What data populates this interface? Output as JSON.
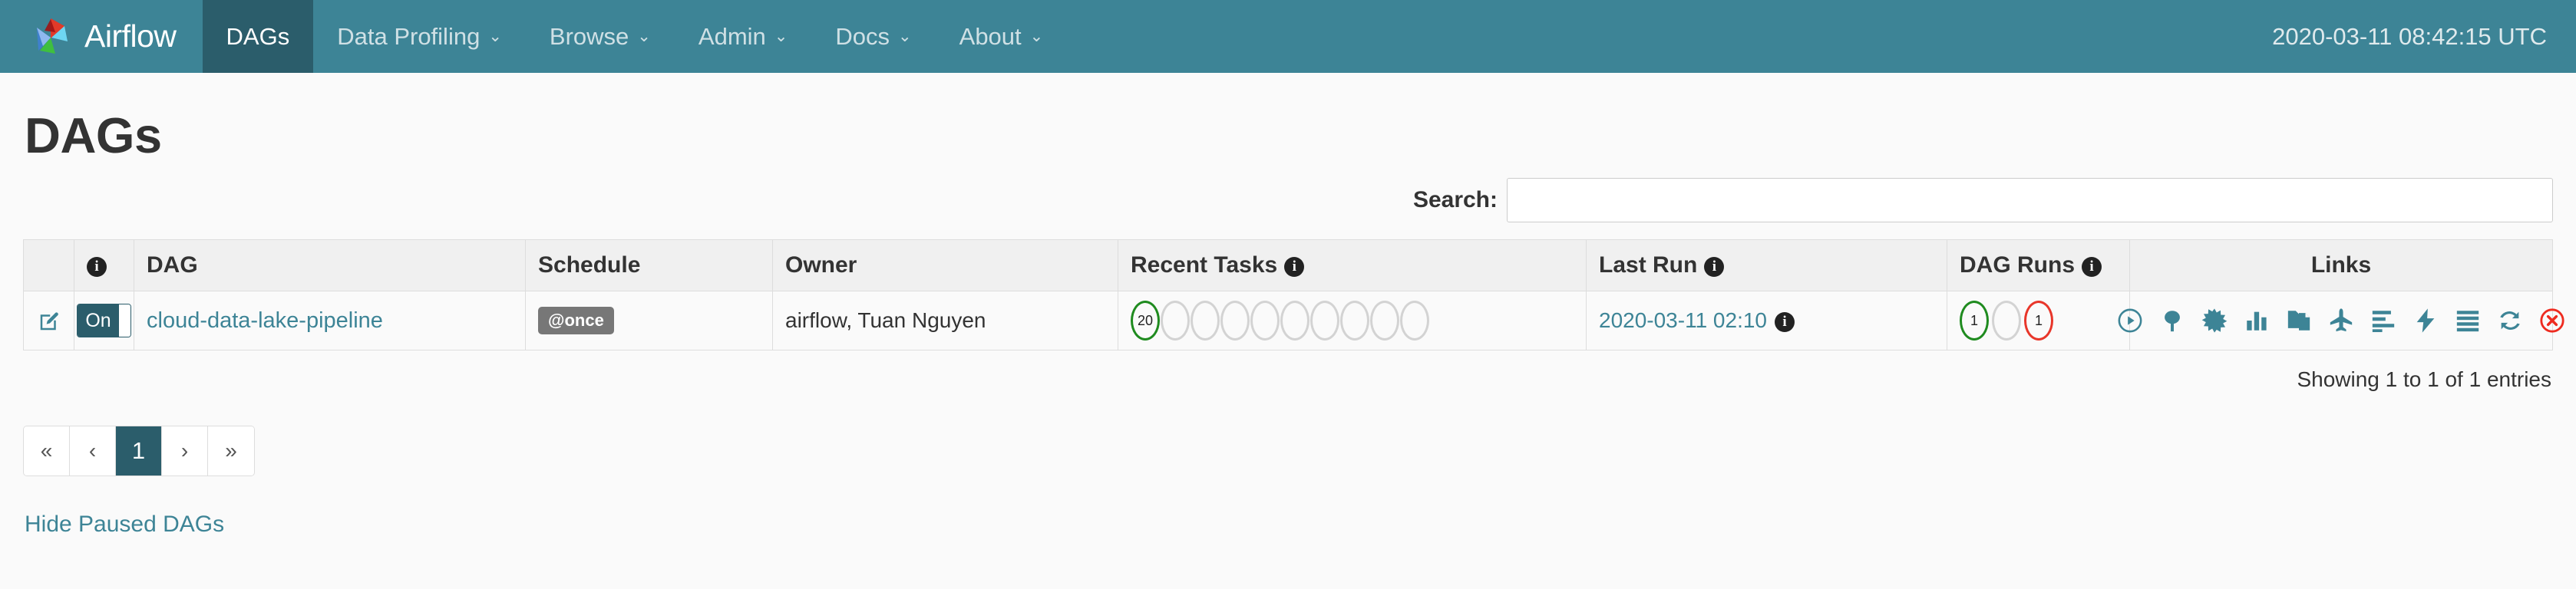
{
  "navbar": {
    "brand_label": "Airflow",
    "brand_icon": "airflow-pinwheel-logo",
    "items": [
      {
        "label": "DAGs",
        "caret": "",
        "active": true
      },
      {
        "label": "Data Profiling",
        "caret": "⌄",
        "active": false
      },
      {
        "label": "Browse",
        "caret": "⌄",
        "active": false
      },
      {
        "label": "Admin",
        "caret": "⌄",
        "active": false
      },
      {
        "label": "Docs",
        "caret": "⌄",
        "active": false
      },
      {
        "label": "About",
        "caret": "⌄",
        "active": false
      }
    ],
    "clock": "2020-03-11 08:42:15 UTC",
    "bg_color": "#3d8496",
    "active_bg_color": "#2b5d6b"
  },
  "page": {
    "title": "DAGs"
  },
  "search": {
    "label": "Search:",
    "value": "",
    "placeholder": ""
  },
  "table": {
    "headers": {
      "edit": "",
      "info": "ℹ",
      "dag": "DAG",
      "schedule": "Schedule",
      "owner": "Owner",
      "recent_tasks": "Recent Tasks",
      "last_run": "Last Run",
      "dag_runs": "DAG Runs",
      "links": "Links"
    },
    "rows": [
      {
        "edit_icon": "edit-pencil-square-icon",
        "toggle_label": "On",
        "toggle_state": "on",
        "dag_id": "cloud-data-lake-pipeline",
        "schedule": "@once",
        "owner": "airflow, Tuan Nguyen",
        "recent_tasks": [
          {
            "value": "20",
            "state": "success",
            "color": "#1f8b1f"
          },
          {
            "value": "",
            "state": "empty",
            "color": "#d3d3d3"
          },
          {
            "value": "",
            "state": "empty",
            "color": "#d3d3d3"
          },
          {
            "value": "",
            "state": "empty",
            "color": "#d3d3d3"
          },
          {
            "value": "",
            "state": "empty",
            "color": "#d3d3d3"
          },
          {
            "value": "",
            "state": "empty",
            "color": "#d3d3d3"
          },
          {
            "value": "",
            "state": "empty",
            "color": "#d3d3d3"
          },
          {
            "value": "",
            "state": "empty",
            "color": "#d3d3d3"
          },
          {
            "value": "",
            "state": "empty",
            "color": "#d3d3d3"
          },
          {
            "value": "",
            "state": "empty",
            "color": "#d3d3d3"
          }
        ],
        "last_run": "2020-03-11 02:10",
        "dag_runs": [
          {
            "value": "1",
            "state": "success",
            "color": "#1f8b1f"
          },
          {
            "value": "",
            "state": "running",
            "color": "#d3d3d3"
          },
          {
            "value": "1",
            "state": "failed",
            "color": "#e8362a"
          }
        ],
        "links": [
          {
            "name": "trigger-dag-icon",
            "glyph": "play-circle"
          },
          {
            "name": "tree-view-icon",
            "glyph": "tree"
          },
          {
            "name": "graph-view-icon",
            "glyph": "asterisk-star"
          },
          {
            "name": "task-duration-icon",
            "glyph": "bar-chart"
          },
          {
            "name": "code-view-icon",
            "glyph": "documents"
          },
          {
            "name": "landing-times-icon",
            "glyph": "plane"
          },
          {
            "name": "tries-icon",
            "glyph": "align-left"
          },
          {
            "name": "gantt-view-icon",
            "glyph": "lightning-bolt"
          },
          {
            "name": "details-icon",
            "glyph": "list-lines"
          },
          {
            "name": "refresh-icon",
            "glyph": "refresh-arrows"
          },
          {
            "name": "delete-dag-icon",
            "glyph": "times-circle-red"
          }
        ]
      }
    ]
  },
  "footer": {
    "showing": "Showing 1 to 1 of 1 entries",
    "pagination": [
      {
        "label": "«",
        "active": false,
        "name": "first-page"
      },
      {
        "label": "‹",
        "active": false,
        "name": "prev-page"
      },
      {
        "label": "1",
        "active": true,
        "name": "page-1"
      },
      {
        "label": "›",
        "active": false,
        "name": "next-page"
      },
      {
        "label": "»",
        "active": false,
        "name": "last-page"
      }
    ],
    "hide_paused_label": "Hide Paused DAGs"
  },
  "colors": {
    "teal": "#3d8496",
    "teal_dark": "#2b5d6b",
    "green": "#1f8b1f",
    "red": "#e8362a",
    "gray": "#d3d3d3"
  }
}
